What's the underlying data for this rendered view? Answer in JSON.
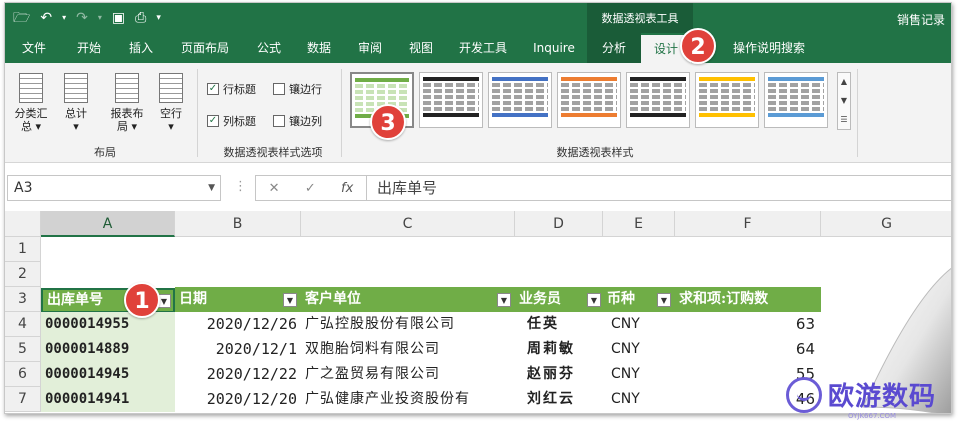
{
  "title_bar": {
    "qat_icons": [
      "folder-open-icon",
      "undo-icon",
      "redo-icon",
      "save-icon",
      "print-preview-icon",
      "customize-qat-icon"
    ],
    "context_title": "数据透视表工具",
    "document_title": "销售记录"
  },
  "tabs": [
    {
      "label": "文件"
    },
    {
      "label": "开始"
    },
    {
      "label": "插入"
    },
    {
      "label": "页面布局"
    },
    {
      "label": "公式"
    },
    {
      "label": "数据"
    },
    {
      "label": "审阅"
    },
    {
      "label": "视图"
    },
    {
      "label": "开发工具"
    },
    {
      "label": "Inquire"
    },
    {
      "label": "分析"
    },
    {
      "label": "设计"
    },
    {
      "label": "操作说明搜索"
    }
  ],
  "ribbon": {
    "layout_group": {
      "label": "布局",
      "buttons": [
        {
          "label1": "分类汇",
          "label2": "总 ▾"
        },
        {
          "label1": "总计",
          "label2": "▾"
        },
        {
          "label1": "报表布",
          "label2": "局 ▾"
        },
        {
          "label1": "空行",
          "label2": "▾"
        }
      ]
    },
    "options_group": {
      "label": "数据透视表样式选项",
      "checks": [
        {
          "label": "行标题",
          "checked": true
        },
        {
          "label": "镶边行",
          "checked": false
        },
        {
          "label": "列标题",
          "checked": true
        },
        {
          "label": "镶边列",
          "checked": false
        }
      ]
    },
    "styles_group": {
      "label": "数据透视表样式",
      "swatch_colors": [
        "#70ad47",
        "#222222",
        "#4472c4",
        "#ed7d31",
        "#222222",
        "#ffc000",
        "#5b9bd5"
      ]
    }
  },
  "formula_bar": {
    "name_box": "A3",
    "cancel": "✕",
    "enter": "✓",
    "fx": "fx",
    "content": "出库单号"
  },
  "grid": {
    "columns": [
      "A",
      "B",
      "C",
      "D",
      "E",
      "F",
      "G"
    ],
    "rows": [
      "1",
      "2",
      "3",
      "4",
      "5",
      "6",
      "7"
    ],
    "header_row": [
      "出库单号",
      "日期",
      "客户单位",
      "业务员",
      "币种",
      "求和项:订购数"
    ],
    "data": [
      {
        "id": "0000014955",
        "date": "2020/12/26",
        "customer": "广弘控股股份有限公司",
        "sales": "任英",
        "currency": "CNY",
        "qty": "63"
      },
      {
        "id": "0000014889",
        "date": "2020/12/1",
        "customer": "双胞胎饲料有限公司",
        "sales": "周莉敏",
        "currency": "CNY",
        "qty": "64"
      },
      {
        "id": "0000014945",
        "date": "2020/12/22",
        "customer": "广之盈贸易有限公司",
        "sales": "赵丽芬",
        "currency": "CNY",
        "qty": "55"
      },
      {
        "id": "0000014941",
        "date": "2020/12/20",
        "customer": "广弘健康产业投资股份有",
        "sales": "刘红云",
        "currency": "CNY",
        "qty": "46"
      }
    ]
  },
  "badges": [
    "1",
    "2",
    "3"
  ],
  "watermark": {
    "text": "欧游数码",
    "sub": "OYJK667.COM"
  },
  "colors": {
    "accent": "#217346",
    "pivot_header": "#70ad47",
    "badge": "#e0413a"
  }
}
